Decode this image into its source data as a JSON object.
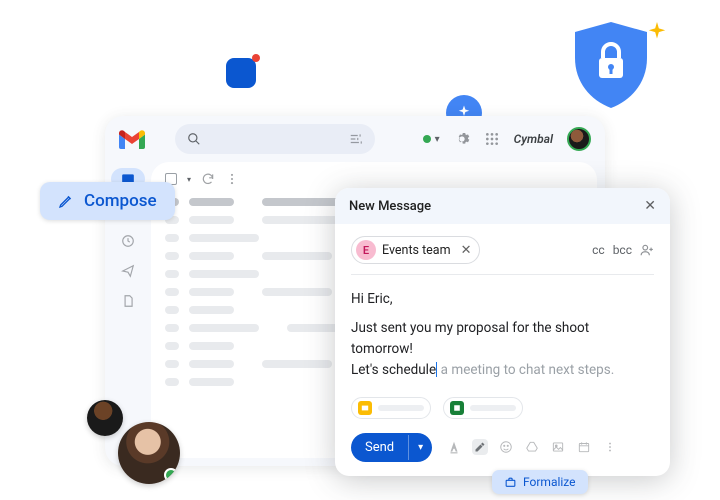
{
  "topbar": {
    "workspace_label": "Cymbal"
  },
  "compose_badge": {
    "label": "Compose"
  },
  "compose": {
    "title": "New Message",
    "recipient_chip": {
      "initial": "E",
      "label": "Events team"
    },
    "cc_label": "cc",
    "bcc_label": "bcc",
    "body": {
      "greeting": "Hi Eric,",
      "line1": "Just sent you my proposal for the shoot tomorrow!",
      "line2_typed": "Let's schedule",
      "line2_suggestion": " a meeting to chat next steps."
    },
    "send_label": "Send"
  },
  "formalize": {
    "label": "Formalize"
  },
  "icons": {
    "search": "search",
    "tune": "tune",
    "gear": "settings",
    "apps": "apps",
    "inbox": "inbox",
    "star": "star",
    "history": "history",
    "sent": "sent",
    "file": "file",
    "refresh": "refresh",
    "more_vert": "more",
    "close": "close",
    "pencil": "pencil",
    "person_add": "person-add",
    "briefcase": "briefcase",
    "sparkle": "sparkle",
    "shield_lock": "shield-lock",
    "chat": "chat"
  }
}
